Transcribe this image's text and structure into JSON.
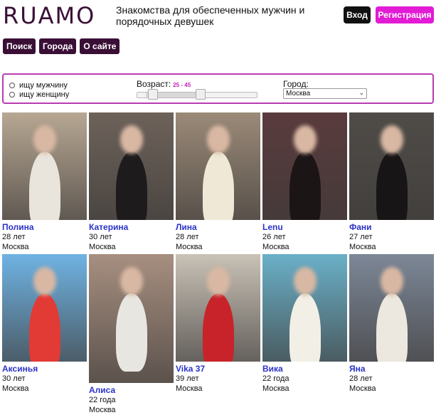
{
  "header": {
    "logo": "RUAMO",
    "tagline": "Знакомства для обеспеченных мужчин и порядочных девушек",
    "login_label": "Вход",
    "register_label": "Регистрация"
  },
  "nav": {
    "items": [
      "Поиск",
      "Города",
      "О сайте"
    ]
  },
  "filter": {
    "options": [
      "ищу мужчину",
      "ищу женщину"
    ],
    "age_label": "Возраст:",
    "age_range": "25 - 45",
    "age_min": 25,
    "age_max": 45,
    "city_label": "Город:",
    "city_value": "Москва"
  },
  "profiles": [
    {
      "name": "Полина",
      "age": "28 лет",
      "city": "Москва",
      "bg": "#b7a793",
      "accent": "#e9e4dc"
    },
    {
      "name": "Катерина",
      "age": "30 лет",
      "city": "Москва",
      "bg": "#6d625a",
      "accent": "#1e1b1c"
    },
    {
      "name": "Лина",
      "age": "28 лет",
      "city": "Москва",
      "bg": "#9b8a78",
      "accent": "#efe8d6"
    },
    {
      "name": "Lenu",
      "age": "26 лет",
      "city": "Москва",
      "bg": "#5a3b3d",
      "accent": "#1c1516"
    },
    {
      "name": "Фани",
      "age": "27 лет",
      "city": "Москва",
      "bg": "#4f4c48",
      "accent": "#171515"
    },
    {
      "name": "Аксинья",
      "age": "30 лет",
      "city": "Москва",
      "bg": "#6fb3e3",
      "accent": "#e23a35"
    },
    {
      "name": "Алиса",
      "age": "22 года",
      "city": "Москва",
      "bg": "#a78f80",
      "accent": "#e8e6e1"
    },
    {
      "name": "Vika 37",
      "age": "39 лет",
      "city": "Москва",
      "bg": "#c9c2b7",
      "accent": "#c8232a"
    },
    {
      "name": "Вика",
      "age": "22 года",
      "city": "Москва",
      "bg": "#6ab0c8",
      "accent": "#f2efe6"
    },
    {
      "name": "Яна",
      "age": "28 лет",
      "city": "Москва",
      "bg": "#7c8797",
      "accent": "#ece7df"
    }
  ],
  "colors": {
    "brand": "#3a0f36",
    "register": "#e21bd4",
    "filter_border": "#b83cb0",
    "name_link": "#2b33c7"
  }
}
